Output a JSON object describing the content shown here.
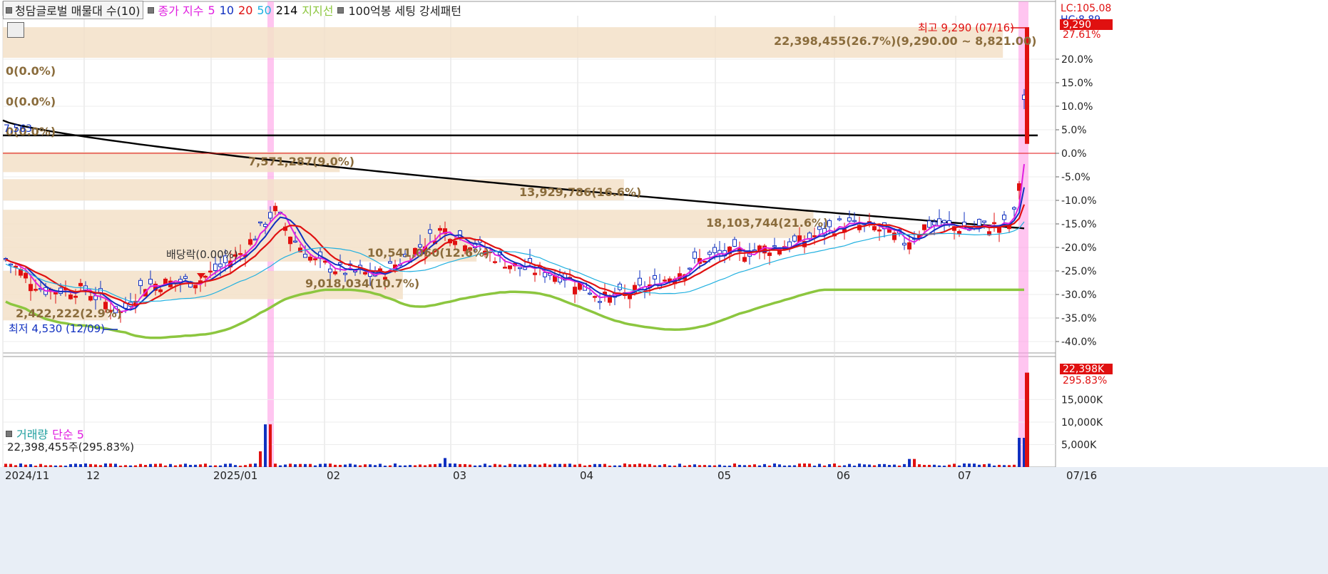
{
  "toolbar": {
    "title": "청담글로벌 매물대 수(10)",
    "ma_label": "종가 지수",
    "ma_periods": [
      "5",
      "10",
      "20",
      "50",
      "214"
    ],
    "ma_colors": [
      "#e020e0",
      "#1030c0",
      "#e01010",
      "#20b0e0",
      "#000000"
    ],
    "support_label": "지지선",
    "pattern_label": "100억봉 세팅 강세패턴"
  },
  "right_badges": {
    "lc": "LC:105.08",
    "hc": "HC:8.89",
    "price_badge": "9,290",
    "vol_badge": "22,398K",
    "vol_pct": "295.83%"
  },
  "chart_data": [
    {
      "type": "candlestick",
      "panel": "price",
      "x_ticks": [
        "2024/11",
        "12",
        "2025/01",
        "02",
        "03",
        "04",
        "05",
        "06",
        "07",
        "07/16"
      ],
      "y_axis_right_percent": [
        "27.61%",
        "20.0%",
        "15.0%",
        "10.0%",
        "5.0%",
        "0.0%",
        "-5.0%",
        "-10.0%",
        "-15.0%",
        "-20.0%",
        "-25.0%",
        "-30.0%",
        "-35.0%",
        "-40.0%"
      ],
      "ylim_percent": [
        -41,
        29
      ],
      "colors": {
        "up": "#e01010",
        "down": "#1030c0",
        "support": "#8cc63f",
        "ma214": "#000000",
        "highlight": "#ff9ee6",
        "profile": "#f3e1c8"
      },
      "annotations": {
        "high": "최고 9,290 (07/16)",
        "low": "최저 4,530 (12/09)",
        "dividend": "배당락(0.00%)",
        "top_profile": "22,398,455(26.7%)(9,290.00 ~ 8,821.00)",
        "ref_price": "7,563"
      },
      "volume_profile": [
        {
          "label": "22,398,455(26.7%)(9,290.00 ~ 8,821.00)",
          "pct_lo": 20.3,
          "pct_hi": 26.8,
          "width_frac": 0.95
        },
        {
          "label": "0(0.0%)",
          "pct_lo": 18.0,
          "pct_hi": 20.3,
          "width_frac": 0.0
        },
        {
          "label": "0(0.0%)",
          "pct_lo": 11.5,
          "pct_hi": 13.5,
          "width_frac": 0.0
        },
        {
          "label": "0(0.0%)",
          "pct_lo": 3.8,
          "pct_hi": 5.3,
          "width_frac": 0.0
        },
        {
          "label": "7,571,287(9.0%)",
          "pct_lo": -4.0,
          "pct_hi": 0.3,
          "width_frac": 0.32
        },
        {
          "label": "13,929,786(16.6%)",
          "pct_lo": -10.0,
          "pct_hi": -5.5,
          "width_frac": 0.59
        },
        {
          "label": "18,103,744(21.6%)",
          "pct_lo": -18.0,
          "pct_hi": -12.0,
          "width_frac": 0.77
        },
        {
          "label": "10,541,060(12.6%)",
          "pct_lo": -23.0,
          "pct_hi": -18.0,
          "width_frac": 0.45
        },
        {
          "label": "9,018,034(10.7%)",
          "pct_lo": -31.0,
          "pct_hi": -25.0,
          "width_frac": 0.38
        },
        {
          "label": "2,422,222(2.9%)",
          "pct_lo": -35.5,
          "pct_hi": -31.0,
          "width_frac": 0.1
        }
      ],
      "ma214_start_pct": 7.0,
      "hline_pct": 3.8,
      "redline_pct": 0.0
    },
    {
      "type": "bar",
      "panel": "volume",
      "title": "거래량",
      "ma_label": "단순 5",
      "summary": "22,398,455주(295.83%)",
      "y_ticks": [
        "15,000K",
        "10,000K",
        "5,000K"
      ],
      "ylim_k": [
        0,
        23000
      ]
    }
  ]
}
